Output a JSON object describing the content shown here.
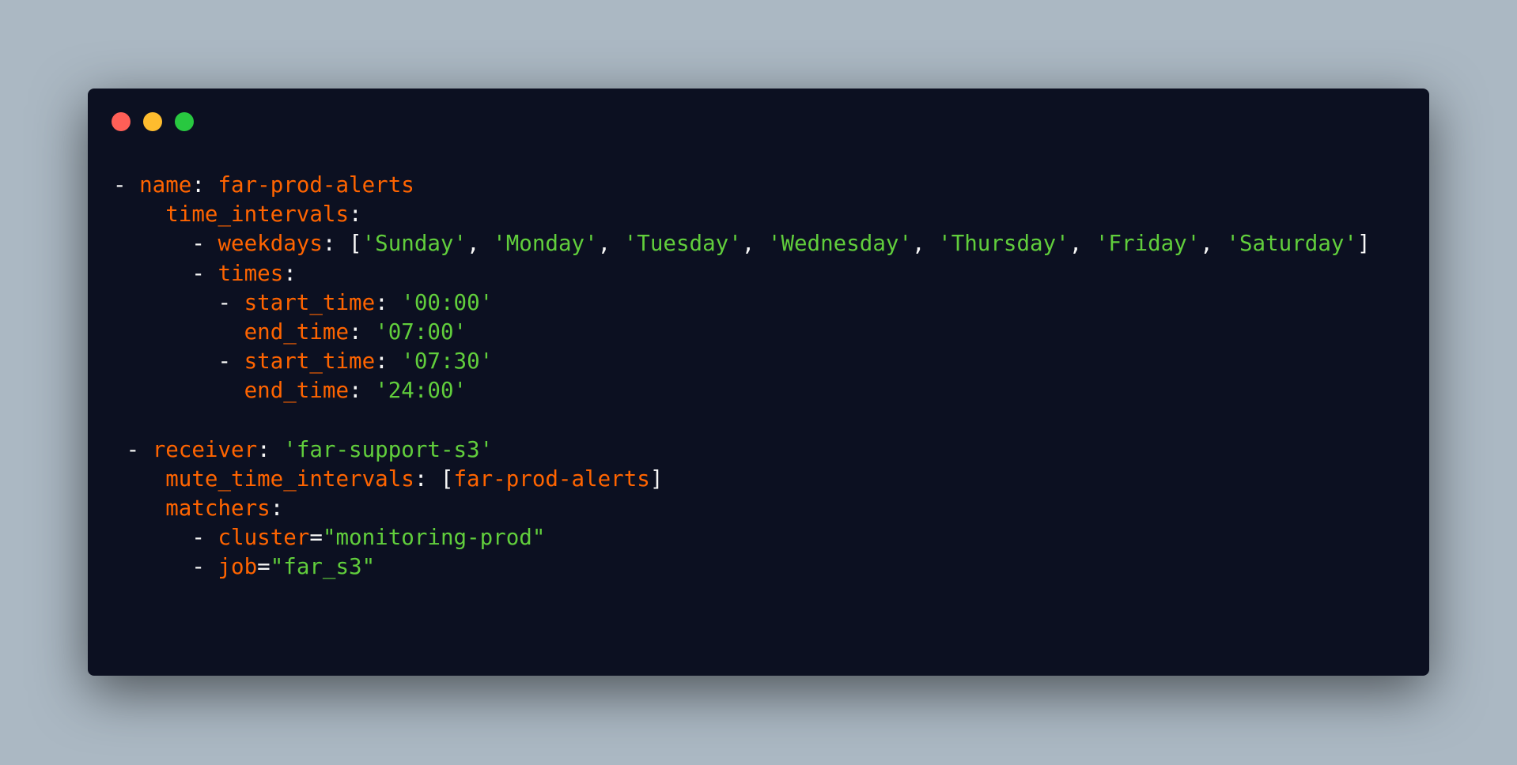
{
  "window": {
    "controls": [
      "close",
      "minimize",
      "maximize"
    ]
  },
  "code": {
    "language": "yaml",
    "colors": {
      "background": "#0c1021",
      "punctuation": "#f8f8f8",
      "key": "#ff6400",
      "string": "#61ce3c"
    },
    "lines": [
      {
        "indent": "",
        "tokens": [
          {
            "t": "- ",
            "c": "p"
          },
          {
            "t": "name",
            "c": "k"
          },
          {
            "t": ": ",
            "c": "p"
          },
          {
            "t": "far-prod-alerts",
            "c": "k"
          }
        ]
      },
      {
        "indent": "    ",
        "tokens": [
          {
            "t": "time_intervals",
            "c": "k"
          },
          {
            "t": ":",
            "c": "p"
          }
        ]
      },
      {
        "indent": "      ",
        "tokens": [
          {
            "t": "- ",
            "c": "p"
          },
          {
            "t": "weekdays",
            "c": "k"
          },
          {
            "t": ": [",
            "c": "p"
          },
          {
            "t": "'Sunday'",
            "c": "s"
          },
          {
            "t": ", ",
            "c": "p"
          },
          {
            "t": "'Monday'",
            "c": "s"
          },
          {
            "t": ", ",
            "c": "p"
          },
          {
            "t": "'Tuesday'",
            "c": "s"
          },
          {
            "t": ", ",
            "c": "p"
          },
          {
            "t": "'Wednesday'",
            "c": "s"
          },
          {
            "t": ", ",
            "c": "p"
          },
          {
            "t": "'Thursday'",
            "c": "s"
          },
          {
            "t": ", ",
            "c": "p"
          },
          {
            "t": "'Friday'",
            "c": "s"
          },
          {
            "t": ", ",
            "c": "p"
          },
          {
            "t": "'Saturday'",
            "c": "s"
          },
          {
            "t": "]",
            "c": "p"
          }
        ]
      },
      {
        "indent": "      ",
        "tokens": [
          {
            "t": "- ",
            "c": "p"
          },
          {
            "t": "times",
            "c": "k"
          },
          {
            "t": ":",
            "c": "p"
          }
        ]
      },
      {
        "indent": "        ",
        "tokens": [
          {
            "t": "- ",
            "c": "p"
          },
          {
            "t": "start_time",
            "c": "k"
          },
          {
            "t": ": ",
            "c": "p"
          },
          {
            "t": "'00:00'",
            "c": "s"
          }
        ]
      },
      {
        "indent": "          ",
        "tokens": [
          {
            "t": "end_time",
            "c": "k"
          },
          {
            "t": ": ",
            "c": "p"
          },
          {
            "t": "'07:00'",
            "c": "s"
          }
        ]
      },
      {
        "indent": "        ",
        "tokens": [
          {
            "t": "- ",
            "c": "p"
          },
          {
            "t": "start_time",
            "c": "k"
          },
          {
            "t": ": ",
            "c": "p"
          },
          {
            "t": "'07:30'",
            "c": "s"
          }
        ]
      },
      {
        "indent": "          ",
        "tokens": [
          {
            "t": "end_time",
            "c": "k"
          },
          {
            "t": ": ",
            "c": "p"
          },
          {
            "t": "'24:00'",
            "c": "s"
          }
        ]
      },
      {
        "indent": "",
        "tokens": []
      },
      {
        "indent": " ",
        "tokens": [
          {
            "t": "- ",
            "c": "p"
          },
          {
            "t": "receiver",
            "c": "k"
          },
          {
            "t": ": ",
            "c": "p"
          },
          {
            "t": "'far-support-s3'",
            "c": "s"
          }
        ]
      },
      {
        "indent": "    ",
        "tokens": [
          {
            "t": "mute_time_intervals",
            "c": "k"
          },
          {
            "t": ": [",
            "c": "p"
          },
          {
            "t": "far-prod-alerts",
            "c": "k"
          },
          {
            "t": "]",
            "c": "p"
          }
        ]
      },
      {
        "indent": "    ",
        "tokens": [
          {
            "t": "matchers",
            "c": "k"
          },
          {
            "t": ":",
            "c": "p"
          }
        ]
      },
      {
        "indent": "      ",
        "tokens": [
          {
            "t": "- ",
            "c": "p"
          },
          {
            "t": "cluster",
            "c": "k"
          },
          {
            "t": "=",
            "c": "p"
          },
          {
            "t": "\"monitoring-prod\"",
            "c": "s"
          }
        ]
      },
      {
        "indent": "      ",
        "tokens": [
          {
            "t": "- ",
            "c": "p"
          },
          {
            "t": "job",
            "c": "k"
          },
          {
            "t": "=",
            "c": "p"
          },
          {
            "t": "\"far_s3\"",
            "c": "s"
          }
        ]
      }
    ]
  }
}
